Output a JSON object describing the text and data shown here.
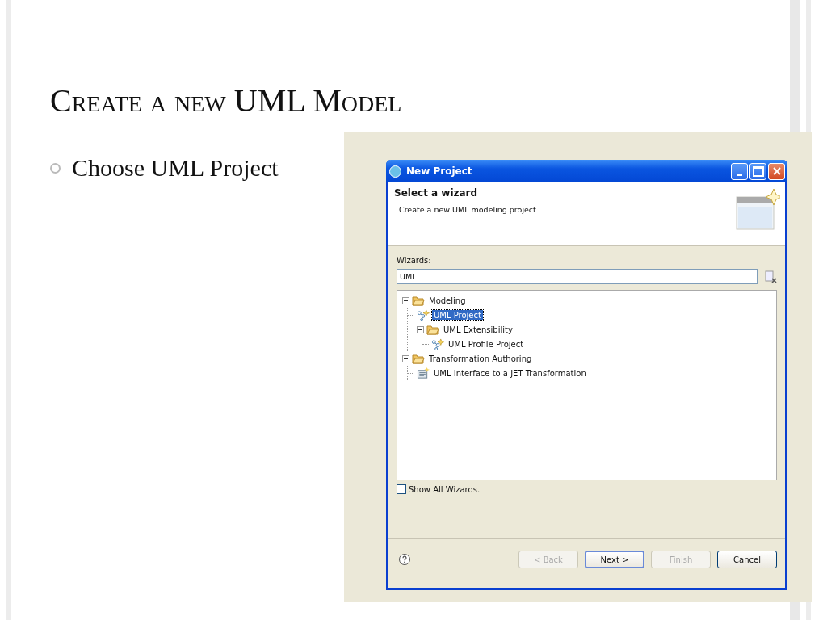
{
  "slide": {
    "title": "Create a new UML Model",
    "bullets": [
      "Choose UML Project"
    ]
  },
  "dialog": {
    "title": "New Project",
    "header": {
      "title": "Select a wizard",
      "description": "Create a new UML modeling project"
    },
    "wizards": {
      "label": "Wizards:",
      "value": "UML",
      "tree": [
        {
          "label": "Modeling",
          "kind": "folder",
          "expanded": true,
          "children": [
            {
              "label": "UML Project",
              "kind": "project",
              "selected": true
            },
            {
              "label": "UML Extensibility",
              "kind": "folder",
              "expanded": true,
              "children": [
                {
                  "label": "UML Profile Project",
                  "kind": "project",
                  "selected": false
                }
              ]
            }
          ]
        },
        {
          "label": "Transformation Authoring",
          "kind": "folder",
          "expanded": true,
          "children": [
            {
              "label": "UML Interface to a JET Transformation",
              "kind": "transform",
              "selected": false
            }
          ]
        }
      ]
    },
    "show_all": {
      "label": "Show All Wizards.",
      "checked": false
    },
    "buttons": [
      {
        "label": "< Back",
        "disabled": true,
        "default": false
      },
      {
        "label": "Next >",
        "disabled": false,
        "default": true
      },
      {
        "label": "Finish",
        "disabled": true,
        "default": false
      },
      {
        "label": "Cancel",
        "disabled": false,
        "default": false
      }
    ]
  }
}
